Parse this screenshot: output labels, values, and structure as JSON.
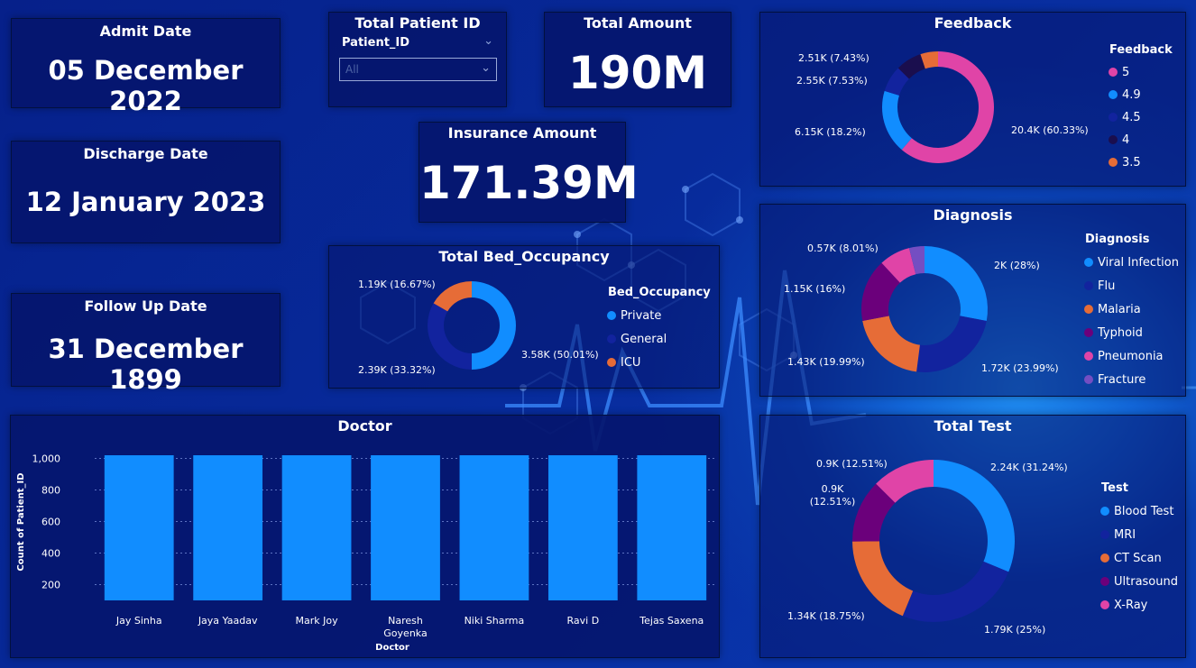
{
  "admit": {
    "title": "Admit Date",
    "value": "05 December 2022"
  },
  "discharge": {
    "title": "Discharge Date",
    "value": "12 January 2023"
  },
  "followup": {
    "title": "Follow Up Date",
    "value": "31 December 1899"
  },
  "patient_slicer": {
    "title": "Total Patient ID",
    "field": "Patient_ID",
    "selected": "All"
  },
  "total_amount": {
    "title": "Total Amount",
    "value": "190M"
  },
  "insurance": {
    "title": "Insurance Amount",
    "value": "171.39M"
  },
  "colors": {
    "blue": "#118dff",
    "navy": "#12239e",
    "orange": "#e66c37",
    "purple": "#6b007b",
    "pink": "#e044a7",
    "lavender": "#744ec2",
    "dark": "#1a0e4e"
  },
  "chart_data": [
    {
      "id": "bed",
      "type": "pie",
      "title": "Total Bed_Occupancy",
      "legend_title": "Bed_Occupancy",
      "legend_position": "right",
      "labels": [
        "Private",
        "General",
        "ICU"
      ],
      "values": [
        3580,
        2390,
        1190
      ],
      "data_labels": [
        "3.58K (50.01%)",
        "2.39K (33.32%)",
        "1.19K (16.67%)"
      ],
      "colors": [
        "#118dff",
        "#12239e",
        "#e66c37"
      ]
    },
    {
      "id": "feedback",
      "type": "pie",
      "title": "Feedback",
      "legend_title": "Feedback",
      "legend_position": "right",
      "labels": [
        "5",
        "4.9",
        "4.5",
        "4",
        "3.5"
      ],
      "values": [
        20400,
        6150,
        2550,
        2510,
        1700
      ],
      "data_labels": [
        "20.4K (60.33%)",
        "6.15K (18.2%)",
        "2.55K (7.53%)",
        "2.51K (7.43%)",
        ""
      ],
      "colors": [
        "#e044a7",
        "#118dff",
        "#12239e",
        "#1a0e4e",
        "#e66c37"
      ]
    },
    {
      "id": "diagnosis",
      "type": "pie",
      "title": "Diagnosis",
      "legend_title": "Diagnosis",
      "legend_position": "right",
      "labels": [
        "Viral Infection",
        "Flu",
        "Malaria",
        "Typhoid",
        "Pneumonia",
        "Fracture"
      ],
      "values": [
        2000,
        1720,
        1430,
        1150,
        570,
        280
      ],
      "data_labels": [
        "2K (28%)",
        "1.72K (23.99%)",
        "1.43K (19.99%)",
        "1.15K (16%)",
        "0.57K (8.01%)",
        ""
      ],
      "colors": [
        "#118dff",
        "#12239e",
        "#e66c37",
        "#6b007b",
        "#e044a7",
        "#744ec2"
      ]
    },
    {
      "id": "test",
      "type": "pie",
      "title": "Total Test",
      "legend_title": "Test",
      "legend_position": "right",
      "labels": [
        "Blood Test",
        "MRI",
        "CT Scan",
        "Ultrasound",
        "X-Ray"
      ],
      "values": [
        2240,
        1790,
        1340,
        900,
        900
      ],
      "data_labels": [
        "2.24K (31.24%)",
        "1.79K (25%)",
        "1.34K (18.75%)",
        "0.9K\n(12.51%)",
        "0.9K (12.51%)"
      ],
      "colors": [
        "#118dff",
        "#12239e",
        "#e66c37",
        "#6b007b",
        "#e044a7"
      ]
    },
    {
      "id": "doctor",
      "type": "bar",
      "title": "Doctor",
      "xlabel": "Doctor",
      "ylabel": "Count of Patient_ID",
      "categories": [
        "Jay Sinha",
        "Jaya Yaadav",
        "Mark Joy",
        "Naresh Goyenka",
        "Niki Sharma",
        "Ravi D",
        "Tejas Saxena"
      ],
      "values": [
        1020,
        1020,
        1020,
        1020,
        1020,
        1020,
        1020
      ],
      "ylim": [
        100,
        1100
      ],
      "yticks": [
        200,
        400,
        600,
        800,
        1000
      ],
      "ytick_labels": [
        "200",
        "400",
        "600",
        "800",
        "1,000"
      ],
      "grid": true,
      "color": "#118dff"
    }
  ]
}
